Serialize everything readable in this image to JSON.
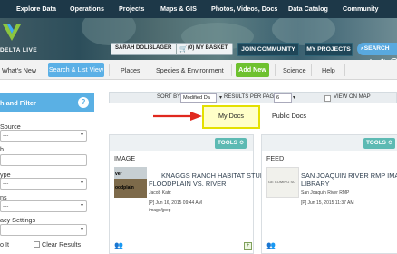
{
  "top_nav": {
    "items": [
      "Explore Data",
      "Operations",
      "Projects",
      "Maps & GIS",
      "Photos, Videos, Docs",
      "Data Catalog",
      "Community"
    ]
  },
  "banner": {
    "logo_text": "DELTA LIVE",
    "user_name": "SARAH DOLISLAGER",
    "basket_label": "(0) MY BASKET",
    "join_label": "JOIN COMMUNITY",
    "projects_label": "MY PROJECTS",
    "search_label": "SEARCH"
  },
  "sub_nav": {
    "items": [
      "What's New",
      "Search & List View",
      "Places",
      "Species & Environment",
      "Add New",
      "Science",
      "Help"
    ]
  },
  "filter_panel": {
    "title": "h and Filter",
    "labels": {
      "source": "Source",
      "h": "h",
      "type": "ype",
      "ns": "ns",
      "privacy": "acy Settings"
    },
    "select_placeholder": "---",
    "bottom_partial": "o It",
    "clear_results_label": "Clear Results"
  },
  "toolbar": {
    "sort_by_label": "SORT BY",
    "sort_by_value": "Modified Da",
    "results_per_page_label": "RESULTS PER PAGE",
    "results_per_page_value": "6",
    "view_on_map_label": "VIEW ON MAP"
  },
  "doc_tabs": {
    "my_docs": "My Docs",
    "public_docs": "Public Docs"
  },
  "cards": [
    {
      "tools_label": "TOOLS",
      "type": "IMAGE",
      "title_line1": "KNAGGS RANCH HABITAT STUDY",
      "title_line2": "FLOODPLAIN VS. RIVER",
      "author": "Jacob Katz",
      "date": "[P] Jun 16, 2015 09:44 AM",
      "format": "image/jpeg",
      "thumb_text_1": "ver",
      "thumb_text_2": "oodplain"
    },
    {
      "tools_label": "TOOLS",
      "type": "FEED",
      "title_line1": "SAN JOAQUIN RIVER RMP IMAGE",
      "title_line2": "LIBRARY",
      "author": "San Joaquin River RMP",
      "date": "[P] Jun 15, 2015 11:37 AM",
      "thumb_text_1": "GE COMING SO"
    }
  ],
  "colors": {
    "top_nav_bg": "#1d3848",
    "accent_blue": "#5bb0e6",
    "add_new_green": "#6ec12f",
    "tools_teal": "#5dbab3",
    "highlight_yellow": "#e4e000",
    "arrow_red": "#e0281e"
  }
}
